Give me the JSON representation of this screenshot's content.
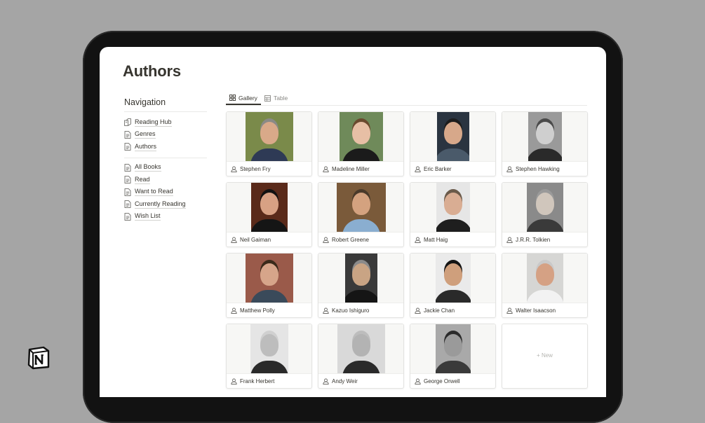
{
  "page": {
    "title": "Authors"
  },
  "navigation": {
    "title": "Navigation",
    "group1": [
      {
        "label": "Reading Hub",
        "icon": "book-stack-icon"
      },
      {
        "label": "Genres",
        "icon": "page-icon"
      },
      {
        "label": "Authors",
        "icon": "page-icon"
      }
    ],
    "group2": [
      {
        "label": "All Books",
        "icon": "page-icon"
      },
      {
        "label": "Read",
        "icon": "page-icon"
      },
      {
        "label": "Want to Read",
        "icon": "page-icon"
      },
      {
        "label": "Currently Reading",
        "icon": "page-icon"
      },
      {
        "label": "Wish List",
        "icon": "page-icon"
      }
    ]
  },
  "views": {
    "gallery_label": "Gallery",
    "table_label": "Table",
    "active": "Gallery"
  },
  "gallery": {
    "cards": [
      {
        "name": "Stephen Fry",
        "bg": "#7a8a4a",
        "skin": "#d9a989",
        "hair": "#8a8a86",
        "shirt": "#2e3a55",
        "w": 68
      },
      {
        "name": "Madeline Miller",
        "bg": "#6f8a5a",
        "skin": "#e7bfa5",
        "hair": "#6a4a2f",
        "shirt": "#1b1b1b",
        "w": 62
      },
      {
        "name": "Eric Barker",
        "bg": "#2a3440",
        "skin": "#d7a88a",
        "hair": "#1d1d1d",
        "shirt": "#4a5a6a",
        "w": 46
      },
      {
        "name": "Stephen Hawking",
        "bg": "#9a9a9a",
        "skin": "#cfcfcf",
        "hair": "#4a4a4a",
        "shirt": "#2a2a2a",
        "w": 48
      },
      {
        "name": "Neil Gaiman",
        "bg": "#5a2a1a",
        "skin": "#d8a184",
        "hair": "#121212",
        "shirt": "#151515",
        "w": 52
      },
      {
        "name": "Robert Greene",
        "bg": "#7a5a3a",
        "skin": "#d4a27f",
        "hair": "#4a3a2a",
        "shirt": "#8aaed0",
        "w": 70
      },
      {
        "name": "Matt Haig",
        "bg": "#e6e6e6",
        "skin": "#d9ad93",
        "hair": "#6a5a4a",
        "shirt": "#1e1e1e",
        "w": 48
      },
      {
        "name": "J.R.R. Tolkien",
        "bg": "#8a8a8a",
        "skin": "#d0c6bc",
        "hair": "#9a9a9a",
        "shirt": "#3a3a3a",
        "w": 52
      },
      {
        "name": "Matthew Polly",
        "bg": "#9a5a4a",
        "skin": "#d6a58a",
        "hair": "#3a2a1a",
        "shirt": "#3a4a5a",
        "w": 68
      },
      {
        "name": "Kazuo Ishiguro",
        "bg": "#3a3a3a",
        "skin": "#c9a484",
        "hair": "#8a8a8a",
        "shirt": "#151515",
        "w": 46
      },
      {
        "name": "Jackie Chan",
        "bg": "#eaeaea",
        "skin": "#cf9f7c",
        "hair": "#141414",
        "shirt": "#2a2a2a",
        "w": 50
      },
      {
        "name": "Walter Isaacson",
        "bg": "#d6d6d4",
        "skin": "#d5a184",
        "hair": "#c9c9c9",
        "shirt": "#f2f2f2",
        "w": 52
      },
      {
        "name": "Frank Herbert",
        "bg": "#e5e5e5",
        "skin": "#bdbdbd",
        "hair": "#d0d0d0",
        "shirt": "#2a2a2a",
        "w": 54
      },
      {
        "name": "Andy Weir",
        "bg": "#d9d9d9",
        "skin": "#b3b3b3",
        "hair": "#bdbdbd",
        "shirt": "#2a2a2a",
        "w": 68
      },
      {
        "name": "George Orwell",
        "bg": "#a9a9a9",
        "skin": "#9a9a9a",
        "hair": "#2a2a2a",
        "shirt": "#3a3a3a",
        "w": 50
      }
    ],
    "new_label": "+ New"
  }
}
